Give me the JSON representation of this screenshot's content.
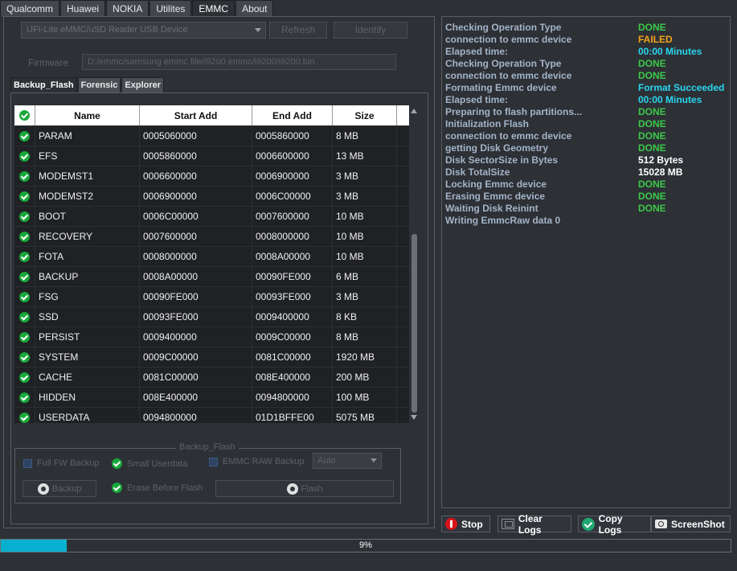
{
  "top_tabs": [
    "Qualcomm",
    "Huawei",
    "NOKIA",
    "Utilites",
    "EMMC",
    "About"
  ],
  "top_tabs_active": "EMMC",
  "device_select_value": "UFI-Lite eMMC/uSD Reader USB Device",
  "refresh_label": "Refresh",
  "identify_label": "Identify",
  "firmware_label": "Firmware",
  "firmware_path": "D:/emmc/samsung emmc file/i9200 emmc/i9200/i9200.bin",
  "sub_tabs": [
    "Backup_Flash",
    "Forensic",
    "Explorer"
  ],
  "table": {
    "headers": [
      "Name",
      "Start Add",
      "End Add",
      "Size"
    ],
    "rows": [
      {
        "name": "PARAM",
        "start": "0005060000",
        "end": "0005860000",
        "size": "8 MB"
      },
      {
        "name": "EFS",
        "start": "0005860000",
        "end": "0006600000",
        "size": "13 MB"
      },
      {
        "name": "MODEMST1",
        "start": "0006600000",
        "end": "0006900000",
        "size": "3 MB"
      },
      {
        "name": "MODEMST2",
        "start": "0006900000",
        "end": "0006C00000",
        "size": "3 MB"
      },
      {
        "name": "BOOT",
        "start": "0006C00000",
        "end": "0007600000",
        "size": "10 MB"
      },
      {
        "name": "RECOVERY",
        "start": "0007600000",
        "end": "0008000000",
        "size": "10 MB"
      },
      {
        "name": "FOTA",
        "start": "0008000000",
        "end": "0008A00000",
        "size": "10 MB"
      },
      {
        "name": "BACKUP",
        "start": "0008A00000",
        "end": "00090FE000",
        "size": "6 MB"
      },
      {
        "name": "FSG",
        "start": "00090FE000",
        "end": "00093FE000",
        "size": "3 MB"
      },
      {
        "name": "SSD",
        "start": "00093FE000",
        "end": "0009400000",
        "size": "8 KB"
      },
      {
        "name": "PERSIST",
        "start": "0009400000",
        "end": "0009C00000",
        "size": "8 MB"
      },
      {
        "name": "SYSTEM",
        "start": "0009C00000",
        "end": "0081C00000",
        "size": "1920 MB"
      },
      {
        "name": "CACHE",
        "start": "0081C00000",
        "end": "008E400000",
        "size": "200 MB"
      },
      {
        "name": "HIDDEN",
        "start": "008E400000",
        "end": "0094800000",
        "size": "100 MB"
      },
      {
        "name": "USERDATA",
        "start": "0094800000",
        "end": "01D1BFFE00",
        "size": "5075 MB"
      }
    ]
  },
  "backup_flash": {
    "title": "Backup_Flash",
    "full_fw_backup": "Full FW Backup",
    "small_userdata": "Small Userdata",
    "emmc_raw_backup": "EMMC RAW Backup",
    "auto_value": "Auto",
    "erase_before_flash": "Erase Before Flash",
    "backup_label": "Backup",
    "flash_label": "Flash"
  },
  "log": [
    {
      "key": "Checking Operation Type",
      "value": "DONE",
      "color": "#3cc94a"
    },
    {
      "key": "connection to emmc device",
      "value": "FAILED",
      "color": "#f2a418"
    },
    {
      "key": "Elapsed time:",
      "value": "00:00  Minutes",
      "color": "#29d6f0"
    },
    {
      "key": "Checking Operation Type",
      "value": "DONE",
      "color": "#3cc94a"
    },
    {
      "key": "connection to emmc device",
      "value": "DONE",
      "color": "#3cc94a"
    },
    {
      "key": "Formating Emmc device",
      "value": "Format Succeeded",
      "color": "#29d6f0"
    },
    {
      "key": "Elapsed time:",
      "value": "00:00  Minutes",
      "color": "#29d6f0"
    },
    {
      "key": "Preparing to flash partitions...",
      "value": "DONE",
      "color": "#3cc94a"
    },
    {
      "key": "Initialization Flash",
      "value": "DONE",
      "color": "#3cc94a"
    },
    {
      "key": "connection to emmc device",
      "value": "DONE",
      "color": "#3cc94a"
    },
    {
      "key": "getting Disk Geometry",
      "value": "DONE",
      "color": "#3cc94a"
    },
    {
      "key": "Disk SectorSize in Bytes",
      "value": "512 Bytes",
      "color": "#ffffff"
    },
    {
      "key": "Disk TotalSize",
      "value": "15028 MB",
      "color": "#ffffff"
    },
    {
      "key": "Locking Emmc device",
      "value": "DONE",
      "color": "#3cc94a"
    },
    {
      "key": "Erasing Emmc device",
      "value": "DONE",
      "color": "#3cc94a"
    },
    {
      "key": "Waiting Disk Reinint",
      "value": "DONE",
      "color": "#3cc94a"
    },
    {
      "key": "Writing EmmcRaw data 0",
      "value": "",
      "color": "#ffffff"
    }
  ],
  "actions": {
    "stop": "Stop",
    "clear_logs": "Clear Logs",
    "copy_logs": "Copy Logs",
    "screenshot": "ScreenShot"
  },
  "progress": {
    "value": 0.09,
    "text": "9%"
  }
}
